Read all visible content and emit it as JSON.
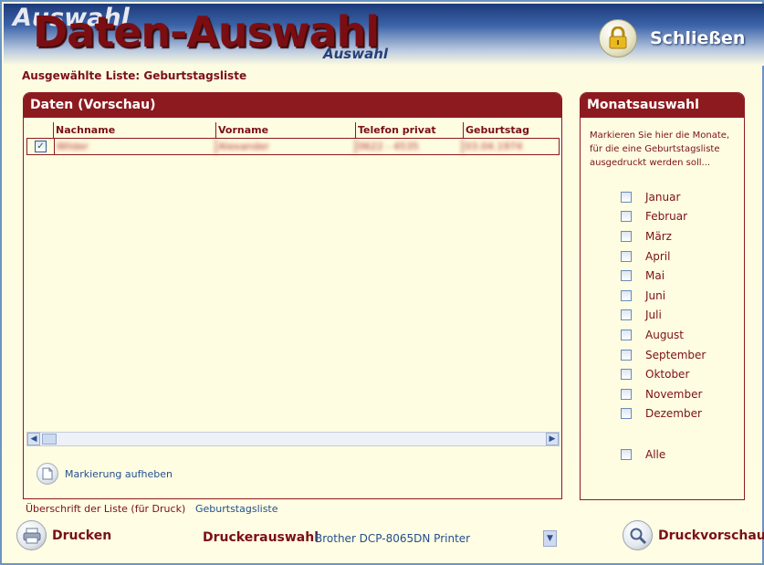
{
  "window": {
    "title_shadow": "Auswahl",
    "title": "Daten-Auswahl",
    "title_sub": "Auswahl",
    "close_label": "Schließen"
  },
  "selected_list": "Ausgewählte Liste: Geburtstagsliste",
  "data_panel": {
    "title": "Daten (Vorschau)",
    "columns": [
      "Nachname",
      "Vorname",
      "Telefon privat",
      "Geburtstag"
    ],
    "rows": [
      {
        "checked": true,
        "cells": [
          "Wilder",
          "Alexander",
          "0622 - 4535",
          "03.04.1974"
        ]
      }
    ],
    "unmark_label": "Markierung aufheben"
  },
  "month_panel": {
    "title": "Monatsauswahl",
    "hint": "Markieren Sie hier die Monate, für die eine Geburtstagsliste ausgedruckt werden soll...",
    "months": [
      "Januar",
      "Februar",
      "März",
      "April",
      "Mai",
      "Juni",
      "Juli",
      "August",
      "September",
      "Oktober",
      "November",
      "Dezember"
    ],
    "all_label": "Alle"
  },
  "print_heading": {
    "label": "Überschrift der Liste (für Druck)",
    "value": "Geburtstagsliste"
  },
  "bottom": {
    "print_label": "Drucken",
    "printer_select_label": "Druckerauswahl",
    "printer_value": "Brother DCP-8065DN Printer",
    "preview_label": "Druckvorschau"
  },
  "icons": {
    "close": "lock-icon",
    "unmark": "document-icon",
    "print": "printer-icon",
    "preview": "magnifier-icon"
  },
  "colors": {
    "accent": "#8d1a1f",
    "background": "#fffde1",
    "link": "#234f90"
  }
}
